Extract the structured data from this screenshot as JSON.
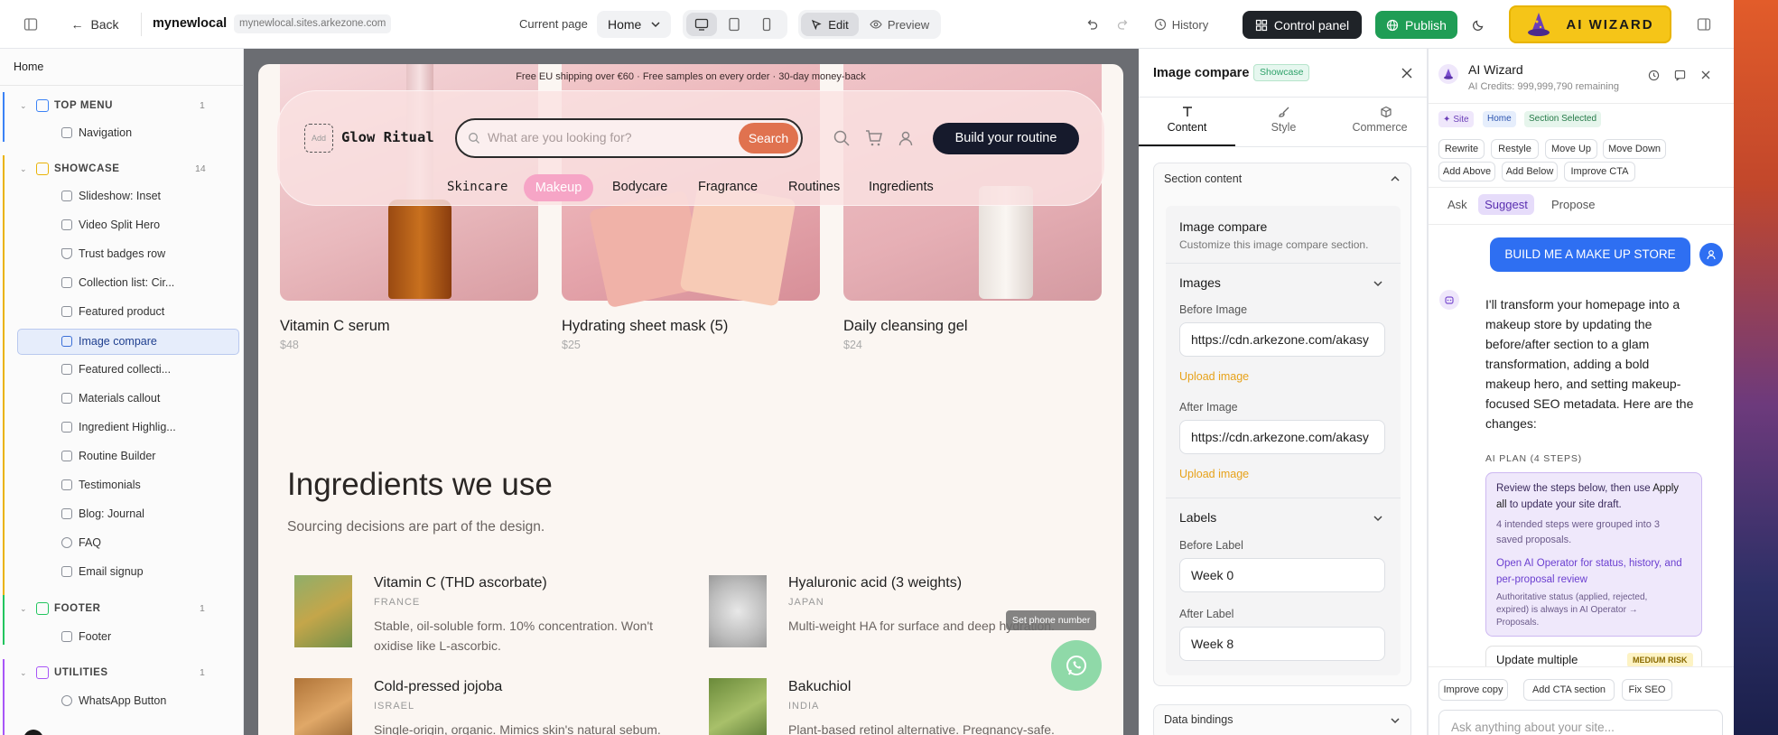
{
  "topbar": {
    "back_label": "Back",
    "site_name": "mynewlocal",
    "site_url": "mynewlocal.sites.arkezone.com",
    "current_page_label": "Current page",
    "current_page_value": "Home",
    "edit_label": "Edit",
    "preview_label": "Preview",
    "history_label": "History",
    "control_panel_label": "Control panel",
    "publish_label": "Publish",
    "ai_wizard_label": "AI WIZARD",
    "colors": {
      "publish": "#1f9d55",
      "ai_wizard": "#f5c518",
      "control_panel": "#1f2328"
    }
  },
  "sidebar": {
    "home_label": "Home",
    "groups": [
      {
        "label": "TOP MENU",
        "count": "1",
        "color": "#3b82f6",
        "items": [
          "Navigation"
        ]
      },
      {
        "label": "SHOWCASE",
        "count": "14",
        "color": "#eab308",
        "items": [
          "Slideshow: Inset",
          "Video Split Hero",
          "Trust badges row",
          "Collection list: Cir...",
          "Featured product",
          "Image compare",
          "Featured collecti...",
          "Materials callout",
          "Ingredient Highlig...",
          "Routine Builder",
          "Testimonials",
          "Blog: Journal",
          "FAQ",
          "Email signup"
        ]
      },
      {
        "label": "FOOTER",
        "count": "1",
        "color": "#22c55e",
        "items": [
          "Footer"
        ]
      },
      {
        "label": "UTILITIES",
        "count": "1",
        "color": "#a855f7",
        "items": [
          "WhatsApp Button"
        ]
      }
    ],
    "selected_item": "Image compare"
  },
  "store": {
    "announcement": "Free EU shipping over €60 · Free samples on every order · 30-day money-back",
    "logo_placeholder": "Add",
    "brand": "Glow Ritual",
    "search_placeholder": "What are you looking for?",
    "search_button": "Search",
    "cta": "Build your routine",
    "nav": [
      "Skincare",
      "Makeup",
      "Bodycare",
      "Fragrance",
      "Routines",
      "Ingredients"
    ],
    "active_nav": "Makeup",
    "products": [
      {
        "name": "Vitamin C serum",
        "price": "$48"
      },
      {
        "name": "Hydrating sheet mask (5)",
        "price": "$25"
      },
      {
        "name": "Daily cleansing gel",
        "price": "$24"
      }
    ],
    "section_title": "Ingredients we use",
    "section_subtitle": "Sourcing decisions are part of the design.",
    "ingredients": [
      {
        "name": "Vitamin C (THD ascorbate)",
        "origin": "FRANCE",
        "desc_1": "Stable, oil-soluble form. 10% concentration. Won't",
        "desc_2": "oxidise like L-ascorbic."
      },
      {
        "name": "Hyaluronic acid (3 weights)",
        "origin": "JAPAN",
        "desc_1": "Multi-weight HA for surface and deep hydration.",
        "desc_2": ""
      },
      {
        "name": "Cold-pressed jojoba",
        "origin": "ISRAEL",
        "desc_1": "Single-origin, organic. Mimics skin's natural sebum.",
        "desc_2": ""
      },
      {
        "name": "Bakuchiol",
        "origin": "INDIA",
        "desc_1": "Plant-based retinol alternative. Pregnancy-safe.",
        "desc_2": ""
      }
    ],
    "whatsapp_tooltip": "Set phone number"
  },
  "props": {
    "title": "Image compare",
    "badge": "Showcase",
    "tabs": [
      "Content",
      "Style",
      "Commerce"
    ],
    "active_tab": "Content",
    "section_content_label": "Section content",
    "card_title": "Image compare",
    "card_subtitle": "Customize this image compare section.",
    "images_label": "Images",
    "before_image_label": "Before Image",
    "before_image_value": "https://cdn.arkezone.com/akasy",
    "upload_label": "Upload image",
    "after_image_label": "After Image",
    "after_image_value": "https://cdn.arkezone.com/akasy",
    "labels_label": "Labels",
    "before_label_label": "Before Label",
    "before_label_value": "Week 0",
    "after_label_label": "After Label",
    "after_label_value": "Week 8",
    "data_bindings_label": "Data bindings"
  },
  "wizard": {
    "title": "AI Wizard",
    "credits": "AI Credits: 999,999,790 remaining",
    "context_chips": [
      "Site",
      "Home",
      "Section Selected"
    ],
    "actions": [
      "Rewrite",
      "Restyle",
      "Move Up",
      "Move Down",
      "Add Above",
      "Add Below",
      "Improve CTA"
    ],
    "modes": [
      "Ask",
      "Suggest",
      "Propose"
    ],
    "active_mode": "Suggest",
    "user_message": "BUILD ME A MAKE UP STORE",
    "ai_lines": [
      "I'll transform your homepage into a",
      "makeup store by updating the",
      "before/after section to a glam",
      "transformation, adding a bold",
      "makeup hero, and setting makeup-",
      "focused SEO metadata. Here are the",
      "changes:"
    ],
    "plan_label": "AI PLAN (4 STEPS)",
    "plan_l1": "Review the steps below, then use ",
    "plan_apply": "Apply",
    "plan_l2a": "all",
    "plan_l2b": " to update your site draft.",
    "plan_grouped_1": "4 intended steps were grouped into 3",
    "plan_grouped_2": "saved proposals.",
    "plan_link_1": "Open AI Operator for status, history, and",
    "plan_link_2": "per-proposal review",
    "plan_note_1": "Authoritative status (applied, rejected,",
    "plan_note_2": "expired) is always in AI Operator →",
    "plan_note_3": "Proposals.",
    "step_title": "Update multiple",
    "risk_badge": "MEDIUM RISK",
    "quick": [
      "Improve copy",
      "Add CTA section",
      "Fix SEO"
    ],
    "input_placeholder": "Ask anything about your site..."
  }
}
